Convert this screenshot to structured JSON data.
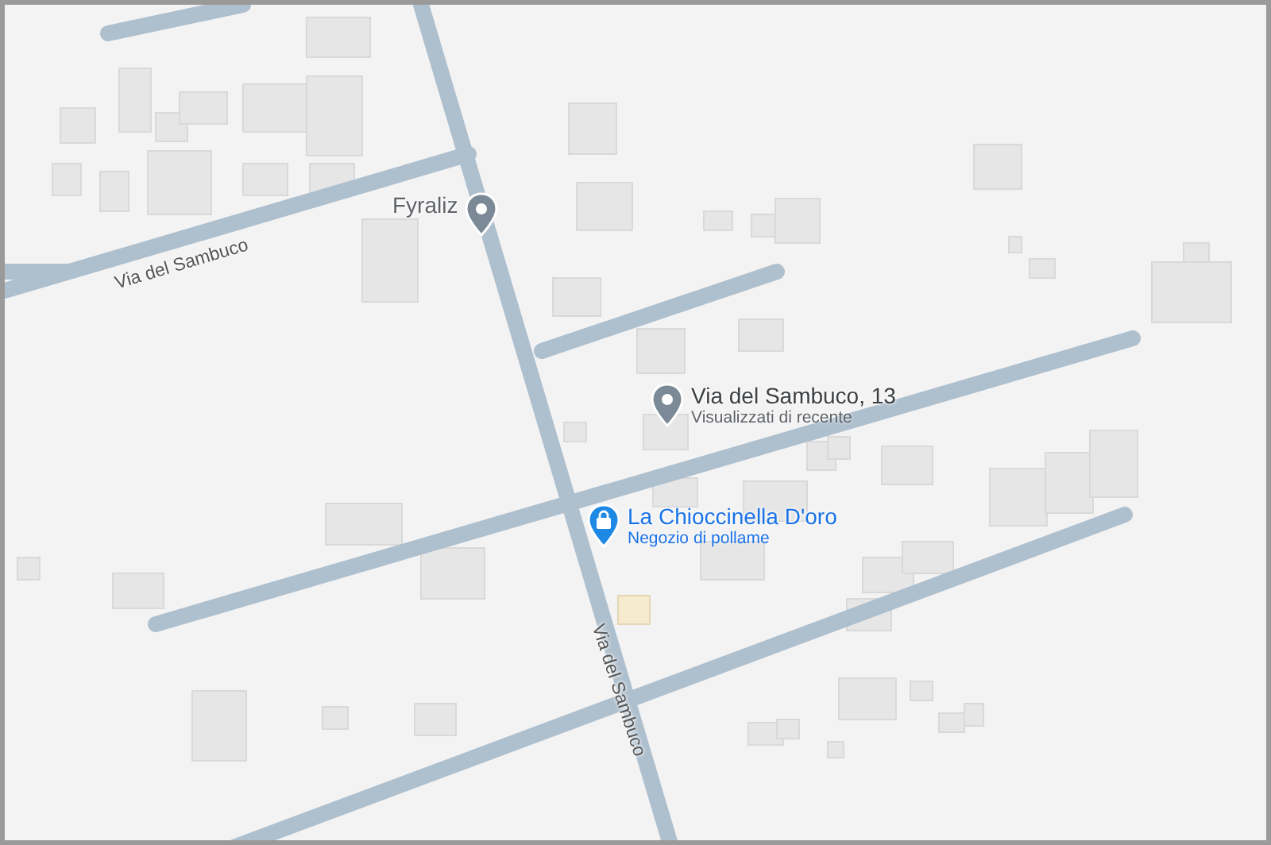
{
  "map": {
    "places": [
      {
        "kind": "poi",
        "name": "Fyraliz"
      },
      {
        "kind": "recent",
        "name": "Via del Sambuco, 13",
        "subtitle": "Visualizzati di recente"
      },
      {
        "kind": "shop",
        "name": "La Chioccinella D'oro",
        "subtitle": "Negozio di pollame"
      }
    ],
    "road_labels": [
      "Via del Sambuco",
      "Via del Sambuco"
    ]
  }
}
